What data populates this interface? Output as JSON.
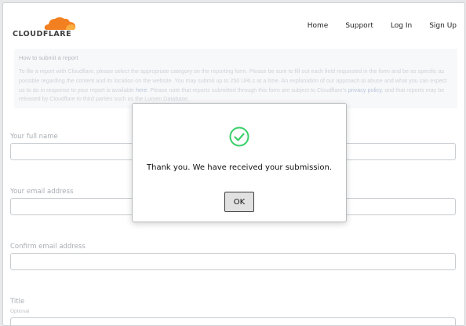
{
  "header": {
    "logo_text": "CLOUDFLARE",
    "nav": [
      "Home",
      "Support",
      "Log In",
      "Sign Up"
    ]
  },
  "info": {
    "title": "How to submit a report",
    "body_1": "To file a report with Cloudflare, please select the appropriate category on the reporting form. Please be sure to fill out each field requested in the form and be as specific as possible regarding the content and its location on the website. You may submit up to 250 URLs at a time. An explanation of our approach to abuse and what you can expect us to do in response to your report is available ",
    "link_here": "here",
    "body_2": ". Please note that reports submitted through this form are subject to Cloudflare's ",
    "link_privacy": "privacy policy",
    "body_3": ", and that reports may be released by Cloudflare to third parties such as the Lumen Database."
  },
  "form": {
    "full_name_label": "Your full name",
    "email_label": "Your email address",
    "confirm_email_label": "Confirm email address",
    "title_label": "Title",
    "title_sublabel": "Optional"
  },
  "modal": {
    "message": "Thank you. We have received your submission.",
    "ok_label": "OK"
  },
  "colors": {
    "brand_orange": "#f38020",
    "success_green": "#3ccf6b"
  }
}
